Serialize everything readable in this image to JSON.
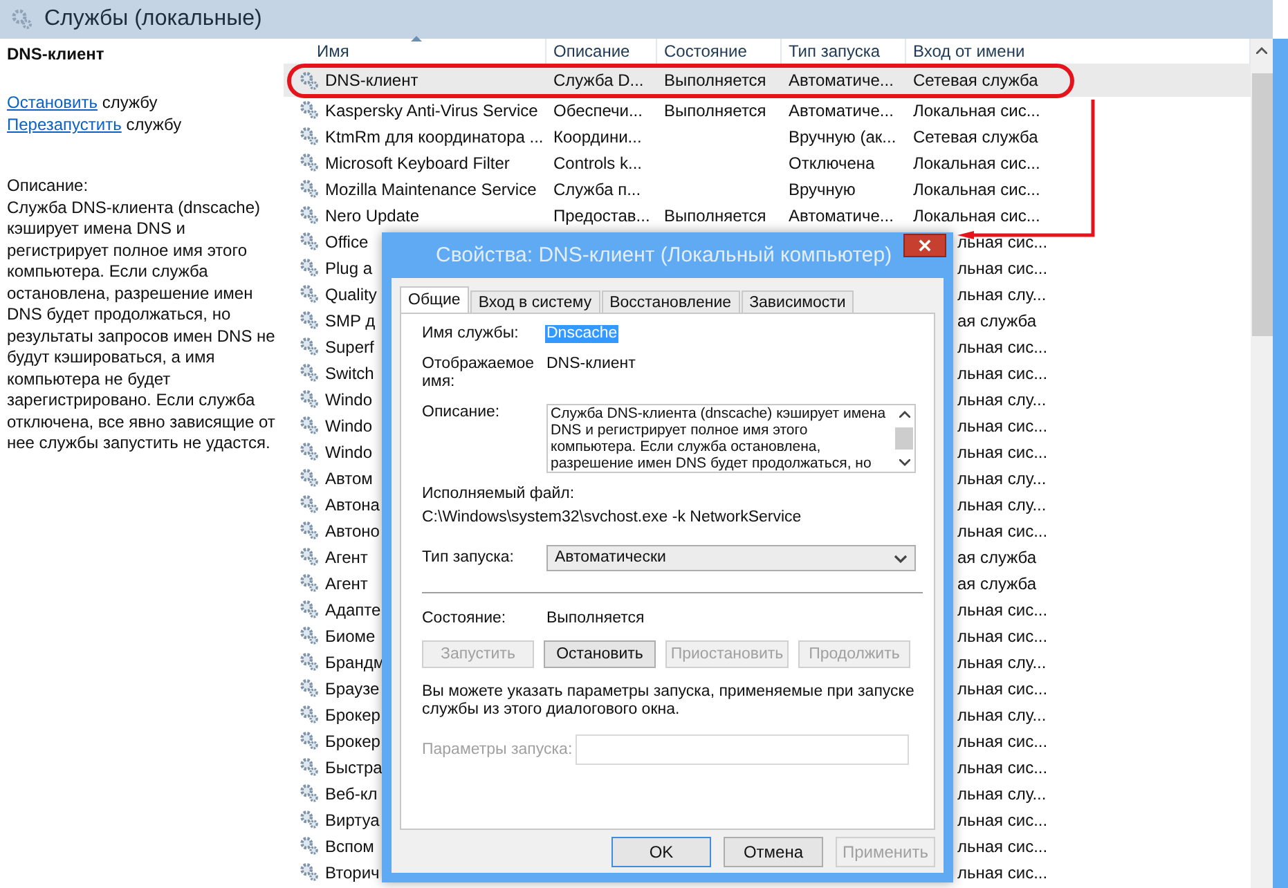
{
  "header": {
    "title": "Службы (локальные)"
  },
  "details": {
    "service_name": "DNS-клиент",
    "actions": [
      {
        "link": "Остановить",
        "text": "службу"
      },
      {
        "link": "Перезапустить",
        "text": "службу"
      }
    ],
    "description_label": "Описание:",
    "description": "Служба DNS-клиента (dnscache) кэширует имена DNS и регистрирует полное имя этого компьютера. Если служба остановлена, разрешение имен DNS будет продолжаться, но результаты запросов имен DNS не будут кэшироваться, а имя компьютера не будет зарегистрировано. Если служба отключена, все явно зависящие от нее службы запустить не удастся."
  },
  "table": {
    "columns": [
      "Имя",
      "Описание",
      "Состояние",
      "Тип запуска",
      "Вход от имени"
    ],
    "rows": [
      {
        "kind": "full",
        "selected": true,
        "name": "DNS-клиент",
        "description": "Служба D...",
        "status": "Выполняется",
        "startup": "Автоматиче...",
        "logon": "Сетевая служба"
      },
      {
        "kind": "full",
        "selected": false,
        "name": "Kaspersky Anti-Virus Service",
        "description": "Обеспечи...",
        "status": "Выполняется",
        "startup": "Автоматиче...",
        "logon": "Локальная сис..."
      },
      {
        "kind": "full",
        "selected": false,
        "name": "KtmRm для координатора ...",
        "description": "Координи...",
        "status": "",
        "startup": "Вручную (ак...",
        "logon": "Сетевая служба"
      },
      {
        "kind": "full",
        "selected": false,
        "name": "Microsoft Keyboard Filter",
        "description": "Controls k...",
        "status": "",
        "startup": "Отключена",
        "logon": "Локальная сис..."
      },
      {
        "kind": "full",
        "selected": false,
        "name": "Mozilla Maintenance Service",
        "description": "Служба п...",
        "status": "",
        "startup": "Вручную",
        "logon": "Локальная сис..."
      },
      {
        "kind": "full",
        "selected": false,
        "name": "Nero Update",
        "description": "Предостав...",
        "status": "Выполняется",
        "startup": "Автоматиче...",
        "logon": "Локальная сис..."
      },
      {
        "kind": "partial",
        "selected": false,
        "name": "Office",
        "logon": "льная сис..."
      },
      {
        "kind": "partial",
        "selected": false,
        "name": "Plug a",
        "logon": "льная сис..."
      },
      {
        "kind": "partial",
        "selected": false,
        "name": "Quality",
        "logon": "льная слу..."
      },
      {
        "kind": "partial",
        "selected": false,
        "name": "SMP д",
        "logon": "ая служба"
      },
      {
        "kind": "partial",
        "selected": false,
        "name": "Superf",
        "logon": "льная сис..."
      },
      {
        "kind": "partial",
        "selected": false,
        "name": "Switch",
        "logon": "льная сис..."
      },
      {
        "kind": "partial",
        "selected": false,
        "name": "Windo",
        "logon": "льная слу..."
      },
      {
        "kind": "partial",
        "selected": false,
        "name": "Windo",
        "logon": "льная сис..."
      },
      {
        "kind": "partial",
        "selected": false,
        "name": "Windo",
        "logon": "льная сис..."
      },
      {
        "kind": "partial",
        "selected": false,
        "name": "Автом",
        "logon": "льная слу..."
      },
      {
        "kind": "partial",
        "selected": false,
        "name": "Автона",
        "logon": "льная слу..."
      },
      {
        "kind": "partial",
        "selected": false,
        "name": "Автоно",
        "logon": "льная сис..."
      },
      {
        "kind": "partial",
        "selected": false,
        "name": "Агент",
        "logon": "ая служба"
      },
      {
        "kind": "partial",
        "selected": false,
        "name": "Агент",
        "logon": "ая служба"
      },
      {
        "kind": "partial",
        "selected": false,
        "name": "Адапте",
        "logon": "льная сис..."
      },
      {
        "kind": "partial",
        "selected": false,
        "name": "Биоме",
        "logon": "льная сис..."
      },
      {
        "kind": "partial",
        "selected": false,
        "name": "Брандм",
        "logon": "льная слу..."
      },
      {
        "kind": "partial",
        "selected": false,
        "name": "Браузе",
        "logon": "льная сис..."
      },
      {
        "kind": "partial",
        "selected": false,
        "name": "Брокер",
        "logon": "льная слу..."
      },
      {
        "kind": "partial",
        "selected": false,
        "name": "Брокер",
        "logon": "льная сис..."
      },
      {
        "kind": "partial",
        "selected": false,
        "name": "Быстра",
        "logon": "льная сис..."
      },
      {
        "kind": "partial",
        "selected": false,
        "name": "Веб-кл",
        "logon": "льная слу..."
      },
      {
        "kind": "partial",
        "selected": false,
        "name": "Виртуа",
        "logon": "льная сис..."
      },
      {
        "kind": "partial",
        "selected": false,
        "name": "Вспом",
        "logon": "льная сис..."
      },
      {
        "kind": "partial",
        "selected": false,
        "name": "Вторич",
        "logon": "льная сис..."
      }
    ]
  },
  "dialog": {
    "title": "Свойства: DNS-клиент (Локальный компьютер)",
    "tabs": [
      {
        "label": "Общие",
        "selected": true
      },
      {
        "label": "Вход в систему",
        "selected": false
      },
      {
        "label": "Восстановление",
        "selected": false
      },
      {
        "label": "Зависимости",
        "selected": false
      }
    ],
    "service_name_label": "Имя службы:",
    "service_name": "Dnscache",
    "display_name_label": "Отображаемое имя:",
    "display_name": "DNS-клиент",
    "description_label": "Описание:",
    "description": "Служба DNS-клиента (dnscache) кэширует имена DNS и регистрирует полное имя этого компьютера. Если служба остановлена, разрешение имен DNS будет продолжаться, но",
    "executable_label": "Исполняемый файл:",
    "executable": "C:\\Windows\\system32\\svchost.exe -k NetworkService",
    "startup_label": "Тип запуска:",
    "startup": "Автоматически",
    "status_label": "Состояние:",
    "status": "Выполняется",
    "control_buttons": [
      {
        "label": "Запустить",
        "disabled": true
      },
      {
        "label": "Остановить",
        "disabled": false
      },
      {
        "label": "Приостановить",
        "disabled": true
      },
      {
        "label": "Продолжить",
        "disabled": true
      }
    ],
    "hint": "Вы можете указать параметры запуска, применяемые при запуске службы из этого диалогового окна.",
    "params_label": "Параметры запуска:",
    "footer_buttons": [
      {
        "label": "OK",
        "disabled": false,
        "default": true
      },
      {
        "label": "Отмена",
        "disabled": false,
        "default": false
      },
      {
        "label": "Применить",
        "disabled": true,
        "default": false
      }
    ]
  }
}
